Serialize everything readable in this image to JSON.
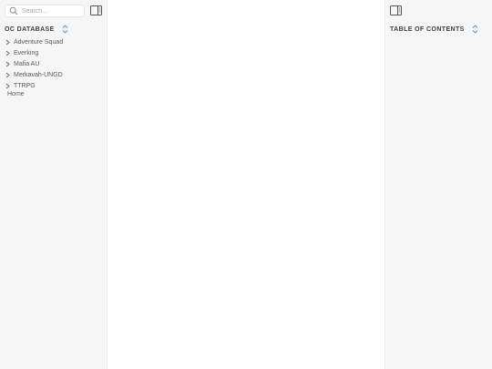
{
  "search": {
    "placeholder": "Search..."
  },
  "left_panel": {
    "header": "OC DATABASE",
    "folders": [
      {
        "label": "Adventure Squad"
      },
      {
        "label": "Everking"
      },
      {
        "label": "Mafia AU"
      },
      {
        "label": "Merkavah-UNGD"
      },
      {
        "label": "TTRPG"
      }
    ],
    "home_label": "Home"
  },
  "right_panel": {
    "header": "TABLE OF CONTENTS"
  },
  "icons": {
    "search": "search-icon",
    "panel_toggle": "sidebar-toggle-icon",
    "sort": "sort-up-down-icon",
    "chevron": "chevron-right-icon"
  },
  "colors": {
    "panel_bg": "#f6f6f6",
    "main_bg": "#ffffff",
    "text": "#5b5b5b",
    "accent": "#4a90c8"
  }
}
